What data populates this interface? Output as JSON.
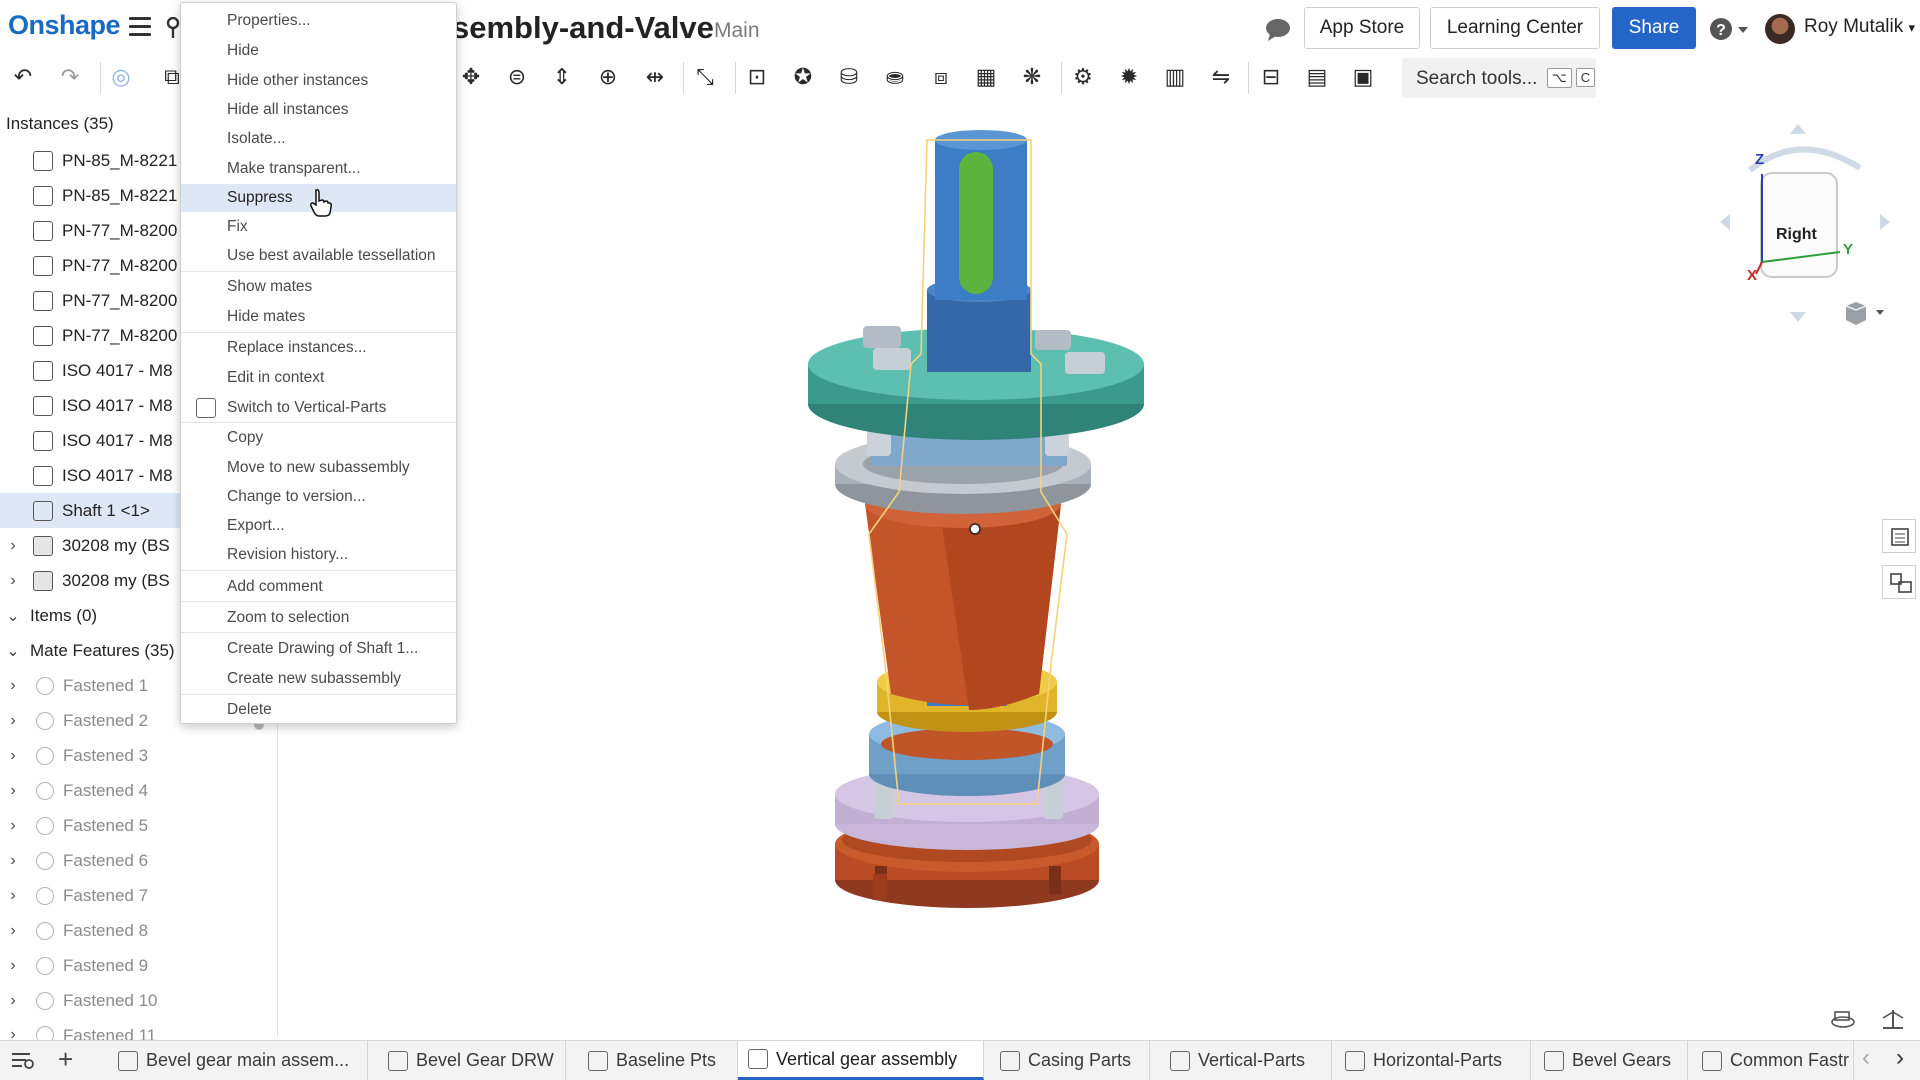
{
  "header": {
    "logo": "Onshape",
    "document_title": "sembly-and-Valve",
    "branch": "Main",
    "app_store": "App Store",
    "learning_center": "Learning Center",
    "share": "Share",
    "user_name": "Roy Mutalik"
  },
  "toolbar": {
    "search_label": "Search tools...",
    "shortcut_1": "⌥",
    "shortcut_2": "C"
  },
  "instances": {
    "header": "Instances (35)",
    "items": [
      {
        "label": "PN-85_M-8221"
      },
      {
        "label": "PN-85_M-8221"
      },
      {
        "label": "PN-77_M-8200"
      },
      {
        "label": "PN-77_M-8200"
      },
      {
        "label": "PN-77_M-8200"
      },
      {
        "label": "PN-77_M-8200"
      },
      {
        "label": "ISO 4017 - M8"
      },
      {
        "label": "ISO 4017 - M8"
      },
      {
        "label": "ISO 4017 - M8"
      },
      {
        "label": "ISO 4017 - M8"
      },
      {
        "label": "Shaft 1 <1>"
      },
      {
        "label": "30208 my (BS"
      },
      {
        "label": "30208 my (BS"
      }
    ]
  },
  "items_section": "Items (0)",
  "mate_features": {
    "header": "Mate Features (35)",
    "items": [
      "Fastened 1",
      "Fastened 2",
      "Fastened 3",
      "Fastened 4",
      "Fastened 5",
      "Fastened 6",
      "Fastened 7",
      "Fastened 8",
      "Fastened 9",
      "Fastened 10",
      "Fastened 11"
    ]
  },
  "context_menu": {
    "items": [
      "Properties...",
      "Hide",
      "Hide other instances",
      "Hide all instances",
      "Isolate...",
      "Make transparent...",
      "Suppress",
      "Fix",
      "Use best available tessellation",
      "Show mates",
      "Hide mates",
      "Replace instances...",
      "Edit in context",
      "Switch to Vertical-Parts",
      "Copy",
      "Move to new subassembly",
      "Change to version...",
      "Export...",
      "Revision history...",
      "Add comment",
      "Zoom to selection",
      "Create Drawing of Shaft 1...",
      "Create new subassembly",
      "Delete"
    ],
    "highlighted": "Suppress"
  },
  "view_cube": {
    "face": "Right",
    "axis_z": "Z",
    "axis_y": "Y",
    "axis_x": "X"
  },
  "tabs": [
    {
      "label": "Bevel gear main assem..."
    },
    {
      "label": "Bevel Gear DRW"
    },
    {
      "label": "Baseline Pts"
    },
    {
      "label": "Vertical gear assembly"
    },
    {
      "label": "Casing Parts"
    },
    {
      "label": "Vertical-Parts"
    },
    {
      "label": "Horizontal-Parts"
    },
    {
      "label": "Bevel Gears"
    },
    {
      "label": "Common Fastr"
    }
  ],
  "active_tab": "Vertical gear assembly",
  "colors": {
    "brand_blue": "#1a6ac2",
    "share_blue": "#2565c7",
    "selection": "#dde7f5",
    "part_orange": "#c4552a",
    "part_blue": "#3d7dc6",
    "part_teal": "#46a89d",
    "part_yellow": "#e0b52a"
  }
}
